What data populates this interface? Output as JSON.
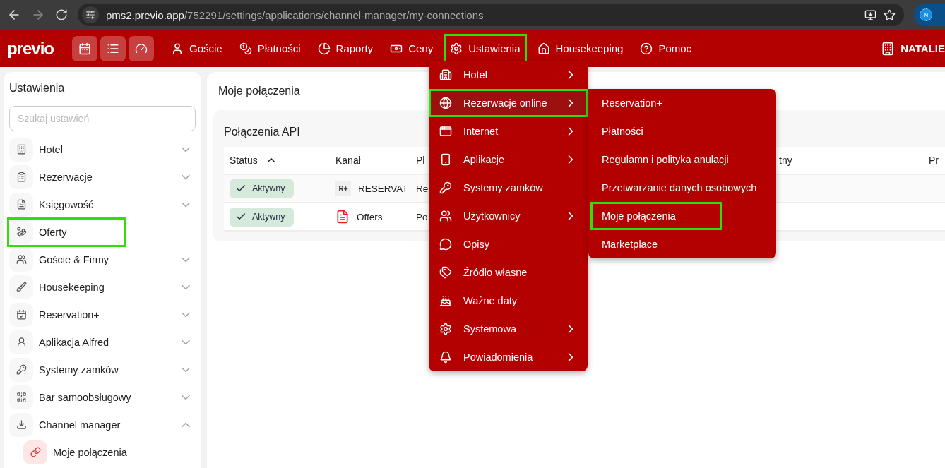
{
  "browser": {
    "url_host": "pms2.previo.app",
    "url_path": "/752291/settings/applications/channel-manager/my-connections",
    "profile_initial": "N"
  },
  "nav": {
    "logo": "previo",
    "items": [
      {
        "label": "Goście",
        "highlighted": false
      },
      {
        "label": "Płatności",
        "highlighted": false
      },
      {
        "label": "Raporty",
        "highlighted": false
      },
      {
        "label": "Ceny",
        "highlighted": false
      },
      {
        "label": "Ustawienia",
        "highlighted": true
      },
      {
        "label": "Housekeeping",
        "highlighted": false
      },
      {
        "label": "Pomoc",
        "highlighted": false
      }
    ],
    "hotel": "NATALIE"
  },
  "sidebar": {
    "title": "Ustawienia",
    "search": {
      "placeholder": "Szukaj ustawień"
    },
    "items": [
      {
        "label": "Hotel",
        "expanded": false,
        "highlighted": false
      },
      {
        "label": "Rezerwacje",
        "expanded": false,
        "highlighted": false
      },
      {
        "label": "Księgowość",
        "expanded": false,
        "highlighted": false
      },
      {
        "label": "Oferty",
        "highlighted": true
      },
      {
        "label": "Goście & Firmy",
        "expanded": false,
        "highlighted": false
      },
      {
        "label": "Housekeeping",
        "expanded": false,
        "highlighted": false
      },
      {
        "label": "Reservation+",
        "expanded": false,
        "highlighted": false
      },
      {
        "label": "Aplikacja Alfred",
        "expanded": false,
        "highlighted": false
      },
      {
        "label": "Systemy zamków",
        "expanded": false,
        "highlighted": false
      },
      {
        "label": "Bar samoobsługowy",
        "expanded": false,
        "highlighted": false
      },
      {
        "label": "Channel manager",
        "expanded": true,
        "highlighted": false,
        "children": [
          {
            "label": "Moje połączenia"
          }
        ]
      }
    ]
  },
  "page": {
    "title": "Moje połączenia",
    "section": "Połączenia API",
    "columns": [
      {
        "label": "Status",
        "sorted": true
      },
      {
        "label": "Kanał",
        "sorted": false
      },
      {
        "label": "Pl",
        "sorted": false
      },
      {
        "label": "tny",
        "sorted": false
      },
      {
        "label": "Pr",
        "sorted": false
      }
    ],
    "rows": [
      {
        "status": "Aktywny",
        "channel_logo": "R+",
        "channel": "RESERVAT",
        "column_3": "Re",
        "kind": "logo"
      },
      {
        "status": "Aktywny",
        "channel": "Offers",
        "column_3": "Po",
        "kind": "offers"
      }
    ]
  },
  "menu": {
    "items": [
      {
        "label": "Hotel",
        "submenu": true,
        "selected": false,
        "highlighted": false
      },
      {
        "label": "Rezerwacje online",
        "submenu": true,
        "selected": true,
        "highlighted": true
      },
      {
        "label": "Internet",
        "submenu": true,
        "selected": false,
        "highlighted": false
      },
      {
        "label": "Aplikacje",
        "submenu": true,
        "selected": false,
        "highlighted": false
      },
      {
        "label": "Systemy zamków",
        "submenu": false,
        "selected": false,
        "highlighted": false
      },
      {
        "label": "Użytkownicy",
        "submenu": true,
        "selected": false,
        "highlighted": false
      },
      {
        "label": "Opisy",
        "submenu": false,
        "selected": false,
        "highlighted": false
      },
      {
        "label": "Źródło własne",
        "submenu": false,
        "selected": false,
        "highlighted": false
      },
      {
        "label": "Ważne daty",
        "submenu": false,
        "selected": false,
        "highlighted": false
      },
      {
        "label": "Systemowa",
        "submenu": true,
        "selected": false,
        "highlighted": false
      },
      {
        "label": "Powiadomienia",
        "submenu": true,
        "selected": false,
        "highlighted": false
      }
    ]
  },
  "submenu": {
    "items": [
      {
        "label": "Reservation+",
        "highlighted": false
      },
      {
        "label": "Płatności",
        "highlighted": false
      },
      {
        "label": "Regulamn i polityka anulacji",
        "highlighted": false
      },
      {
        "label": "Przetwarzanie danych osobowych",
        "highlighted": false
      },
      {
        "label": "Moje połączenia",
        "highlighted": true
      },
      {
        "label": "Marketplace",
        "highlighted": false
      }
    ]
  }
}
